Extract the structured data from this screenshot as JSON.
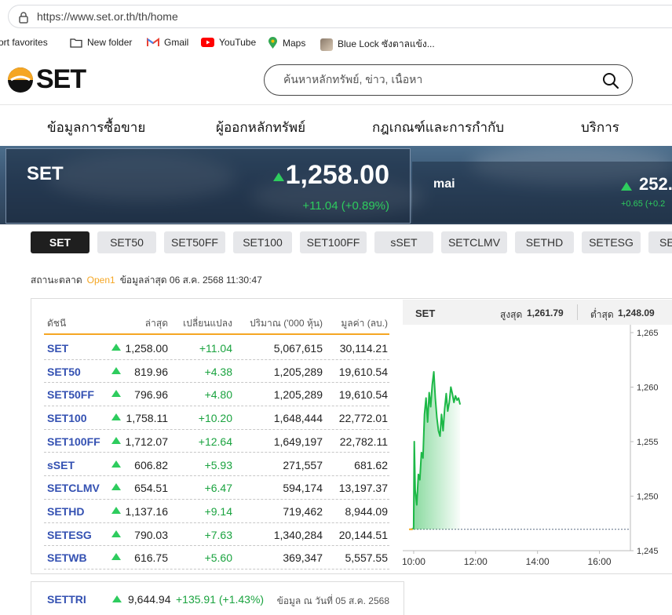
{
  "browser": {
    "url": "https://www.set.or.th/th/home",
    "bookmarks": [
      "ort favorites",
      "New folder",
      "Gmail",
      "YouTube",
      "Maps",
      "Blue Lock ซังตาลแข้ง..."
    ]
  },
  "header": {
    "logo": "SET",
    "search_placeholder": "ค้นหาหลักทรัพย์, ข่าว, เนื้อหา"
  },
  "nav": [
    "ข้อมูลการซื้อขาย",
    "ผู้ออกหลักทรัพย์",
    "กฎเกณฑ์และการกำกับ",
    "บริการ"
  ],
  "banner": {
    "set": {
      "name": "SET",
      "value": "1,258.00",
      "change": "+11.04 (+0.89%)"
    },
    "mai": {
      "name": "mai",
      "value": "252.",
      "change": "+0.65 (+0.2"
    }
  },
  "tabs": [
    "SET",
    "SET50",
    "SET50FF",
    "SET100",
    "SET100FF",
    "sSET",
    "SETCLMV",
    "SETHD",
    "SETESG",
    "SE"
  ],
  "status": {
    "label": "สถานะตลาด",
    "state": "Open1",
    "updated": "ข้อมูลล่าสุด 06 ส.ค. 2568 11:30:47"
  },
  "table": {
    "headers": [
      "ดัชนี",
      "ล่าสุด",
      "เปลี่ยนแปลง",
      "ปริมาณ ('000 หุ้น)",
      "มูลค่า (ลบ.)"
    ],
    "rows": [
      {
        "symbol": "SET",
        "last": "1,258.00",
        "change": "+11.04",
        "volume": "5,067,615",
        "value": "30,114.21"
      },
      {
        "symbol": "SET50",
        "last": "819.96",
        "change": "+4.38",
        "volume": "1,205,289",
        "value": "19,610.54"
      },
      {
        "symbol": "SET50FF",
        "last": "796.96",
        "change": "+4.80",
        "volume": "1,205,289",
        "value": "19,610.54"
      },
      {
        "symbol": "SET100",
        "last": "1,758.11",
        "change": "+10.20",
        "volume": "1,648,444",
        "value": "22,772.01"
      },
      {
        "symbol": "SET100FF",
        "last": "1,712.07",
        "change": "+12.64",
        "volume": "1,649,197",
        "value": "22,782.11"
      },
      {
        "symbol": "sSET",
        "last": "606.82",
        "change": "+5.93",
        "volume": "271,557",
        "value": "681.62"
      },
      {
        "symbol": "SETCLMV",
        "last": "654.51",
        "change": "+6.47",
        "volume": "594,174",
        "value": "13,197.37"
      },
      {
        "symbol": "SETHD",
        "last": "1,137.16",
        "change": "+9.14",
        "volume": "719,462",
        "value": "8,944.09"
      },
      {
        "symbol": "SETESG",
        "last": "790.03",
        "change": "+7.63",
        "volume": "1,340,284",
        "value": "20,144.51"
      },
      {
        "symbol": "SETWB",
        "last": "616.75",
        "change": "+5.60",
        "volume": "369,347",
        "value": "5,557.55"
      }
    ]
  },
  "chart_head": {
    "name": "SET",
    "high_label": "สูงสุด",
    "high": "1,261.79",
    "low_label": "ต่ำสุด",
    "low": "1,248.09"
  },
  "chart_data": {
    "type": "area",
    "xticks": [
      "10:00",
      "12:00",
      "14:00",
      "16:00"
    ],
    "yticks": [
      "1,265",
      "1,260",
      "1,255",
      "1,250",
      "1,245"
    ],
    "ylim": [
      1245,
      1265
    ],
    "xlim_hours": [
      10.0,
      17.0
    ],
    "previous_close": 1246.96,
    "x_hours": [
      9.9,
      9.97,
      10.0,
      10.02,
      10.05,
      10.1,
      10.15,
      10.2,
      10.25,
      10.3,
      10.35,
      10.4,
      10.45,
      10.5,
      10.55,
      10.6,
      10.65,
      10.7,
      10.75,
      10.8,
      10.85,
      10.9,
      10.95,
      11.0,
      11.05,
      11.1,
      11.15,
      11.2,
      11.25,
      11.3,
      11.35,
      11.4,
      11.45,
      11.5
    ],
    "y": [
      1246.96,
      1247.0,
      1247.1,
      1255.0,
      1250.5,
      1249.2,
      1252.0,
      1251.5,
      1254.0,
      1253.5,
      1257.5,
      1259.0,
      1256.8,
      1259.5,
      1258.2,
      1260.2,
      1261.4,
      1259.0,
      1257.2,
      1256.0,
      1255.5,
      1257.5,
      1256.0,
      1258.0,
      1259.4,
      1257.8,
      1258.6,
      1260.0,
      1259.4,
      1258.6,
      1259.2,
      1258.8,
      1259.0,
      1258.4
    ],
    "line_color": "#1db847",
    "grid": false
  },
  "bottom": {
    "symbol": "SETTRI",
    "value": "9,644.94",
    "change": "+135.91 (+1.43%)",
    "note": "ข้อมูล ณ วันที่ 05 ส.ค. 2568"
  }
}
